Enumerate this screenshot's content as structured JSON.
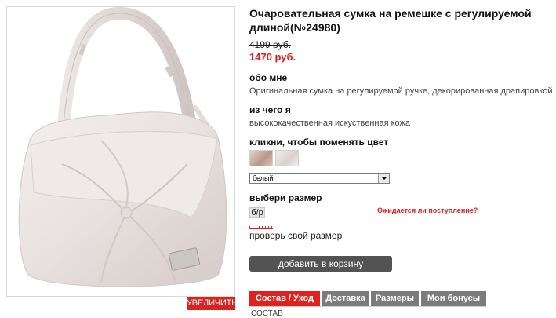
{
  "product": {
    "title": "Очаровательная сумка на ремешке с регулируемой длиной(№24980)",
    "old_price": "4199 руб.",
    "new_price": "1470 руб.",
    "enlarge_label": "УВЕЛИЧИТЬ"
  },
  "about": {
    "heading": "обо мне",
    "text": "Оригинальная сумка на регулируемой ручке, декорированная драпировкой."
  },
  "material": {
    "heading": "из чего я",
    "text": "высококачественная искуственная кожа"
  },
  "color": {
    "heading": "кликни, чтобы поменять цвет",
    "selected": "белый"
  },
  "size": {
    "heading": "выбери размер",
    "value": "б/р",
    "expected_link": "Ожидается ли поступление?",
    "check_link": "проверь свой размер"
  },
  "cart": {
    "button_label": "добавить в корзину"
  },
  "tabs": [
    {
      "label": "Состав / Уход"
    },
    {
      "label": "Доставка"
    },
    {
      "label": "Размеры"
    },
    {
      "label": "Мои бонусы"
    }
  ],
  "tab_content": {
    "text": "СОСТАВ"
  }
}
